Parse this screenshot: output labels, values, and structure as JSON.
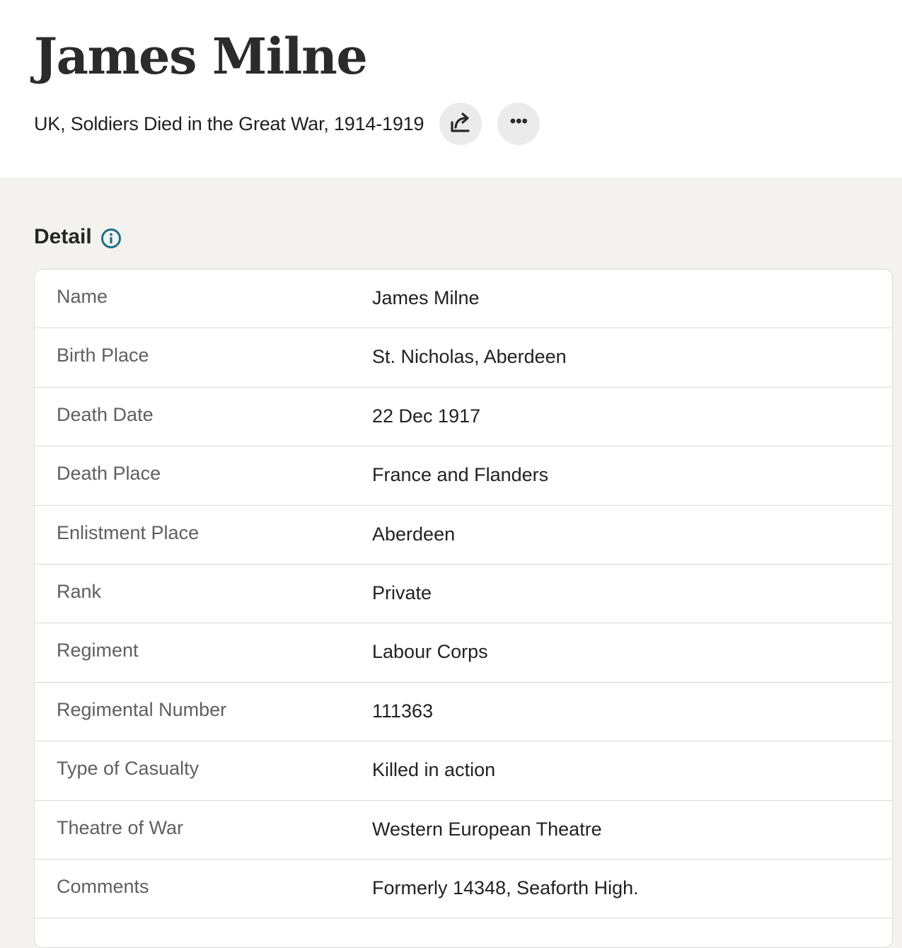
{
  "record": {
    "title": "James Milne",
    "collection": "UK, Soldiers Died in the Great War, 1914-1919"
  },
  "actions": {
    "share_icon": "share-arrow-icon",
    "more_icon": "more-options-icon",
    "more_label": "•••"
  },
  "detail": {
    "heading": "Detail",
    "info_icon": "info-icon",
    "rows": [
      {
        "label": "Name",
        "value": "James Milne"
      },
      {
        "label": "Birth Place",
        "value": "St. Nicholas, Aberdeen"
      },
      {
        "label": "Death Date",
        "value": "22 Dec 1917"
      },
      {
        "label": "Death Place",
        "value": "France and Flanders"
      },
      {
        "label": "Enlistment Place",
        "value": "Aberdeen"
      },
      {
        "label": "Rank",
        "value": "Private"
      },
      {
        "label": "Regiment",
        "value": "Labour Corps"
      },
      {
        "label": "Regimental Number",
        "value": "111363"
      },
      {
        "label": "Type of Casualty",
        "value": "Killed in action"
      },
      {
        "label": "Theatre of War",
        "value": "Western European Theatre"
      },
      {
        "label": "Comments",
        "value": "Formerly 14348, Seaforth High."
      }
    ]
  },
  "colors": {
    "page_background": "#f4f2ee",
    "header_background": "#ffffff",
    "info_icon": "#1b6f8a",
    "button_background": "#ebebeb",
    "row_border": "#dcdad5"
  }
}
